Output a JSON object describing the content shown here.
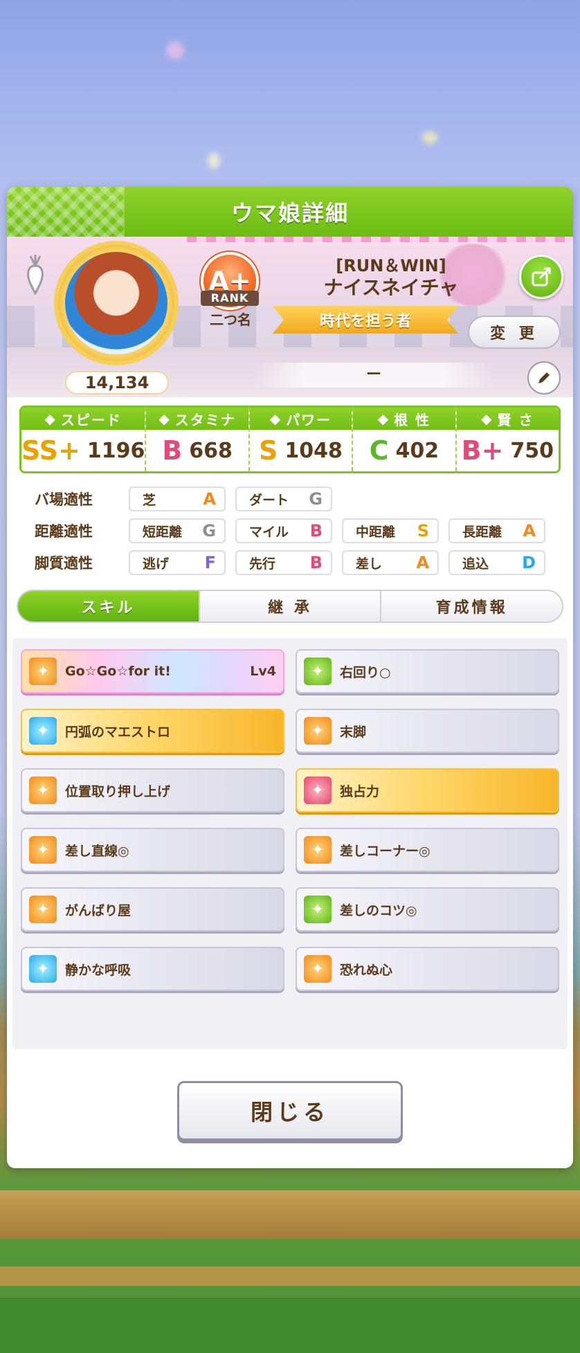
{
  "panel": {
    "title": "ウマ娘詳細"
  },
  "profile": {
    "fan_count": "14,134",
    "rank": "A+",
    "rank_label": "RANK",
    "nickname": "二つ名",
    "char_title": "[RUN＆WIN]",
    "char_name": "ナイスネイチャ",
    "epithet": "時代を担う者",
    "change_label": "変 更",
    "status_text": "ー"
  },
  "stats": [
    {
      "name": "スピード",
      "icon": "shoe-icon",
      "grade": "SS+",
      "value": "1196",
      "color": "#e9a200"
    },
    {
      "name": "スタミナ",
      "icon": "heart-icon",
      "grade": "B",
      "value": "668",
      "color": "#e04b7a"
    },
    {
      "name": "パワー",
      "icon": "muscle-icon",
      "grade": "S",
      "value": "1048",
      "color": "#e9a200"
    },
    {
      "name": "根 性",
      "icon": "flame-icon",
      "grade": "C",
      "value": "402",
      "color": "#5cb82a"
    },
    {
      "name": "賢 さ",
      "icon": "graduation-cap-icon",
      "grade": "B+",
      "value": "750",
      "color": "#e04b7a"
    }
  ],
  "aptitude": {
    "track": {
      "label": "バ場適性",
      "items": [
        {
          "name": "芝",
          "grade": "A",
          "color": "#f08a1c"
        },
        {
          "name": "ダート",
          "grade": "G",
          "color": "#8f8f8f"
        }
      ]
    },
    "distance": {
      "label": "距離適性",
      "items": [
        {
          "name": "短距離",
          "grade": "G",
          "color": "#8f8f8f"
        },
        {
          "name": "マイル",
          "grade": "B",
          "color": "#e04b7a"
        },
        {
          "name": "中距離",
          "grade": "S",
          "color": "#e9a200"
        },
        {
          "name": "長距離",
          "grade": "A",
          "color": "#f08a1c"
        }
      ]
    },
    "style": {
      "label": "脚質適性",
      "items": [
        {
          "name": "逃げ",
          "grade": "F",
          "color": "#7a66d6"
        },
        {
          "name": "先行",
          "grade": "B",
          "color": "#e04b7a"
        },
        {
          "name": "差し",
          "grade": "A",
          "color": "#f08a1c"
        },
        {
          "name": "追込",
          "grade": "D",
          "color": "#2ba8e9"
        }
      ]
    }
  },
  "tabs": [
    {
      "label": "スキル"
    },
    {
      "label": "継 承"
    },
    {
      "label": "育成情報"
    }
  ],
  "skills": [
    {
      "name": "Go☆Go☆for it!",
      "level": "Lv4",
      "style": "rainbow",
      "icon": "orange"
    },
    {
      "name": "右回り○",
      "level": "",
      "style": "normal",
      "icon": "green"
    },
    {
      "name": "円弧のマエストロ",
      "level": "",
      "style": "gold",
      "icon": "blue"
    },
    {
      "name": "末脚",
      "level": "",
      "style": "normal",
      "icon": "orange"
    },
    {
      "name": "位置取り押し上げ",
      "level": "",
      "style": "normal",
      "icon": "orange"
    },
    {
      "name": "独占力",
      "level": "",
      "style": "gold",
      "icon": "red"
    },
    {
      "name": "差し直線◎",
      "level": "",
      "style": "normal",
      "icon": "orange"
    },
    {
      "name": "差しコーナー◎",
      "level": "",
      "style": "normal",
      "icon": "orange"
    },
    {
      "name": "がんばり屋",
      "level": "",
      "style": "normal",
      "icon": "orange"
    },
    {
      "name": "差しのコツ◎",
      "level": "",
      "style": "normal",
      "icon": "green"
    },
    {
      "name": "静かな呼吸",
      "level": "",
      "style": "normal",
      "icon": "blue"
    },
    {
      "name": "恐れぬ心",
      "level": "",
      "style": "normal",
      "icon": "orange"
    }
  ],
  "close_label": "閉じる"
}
